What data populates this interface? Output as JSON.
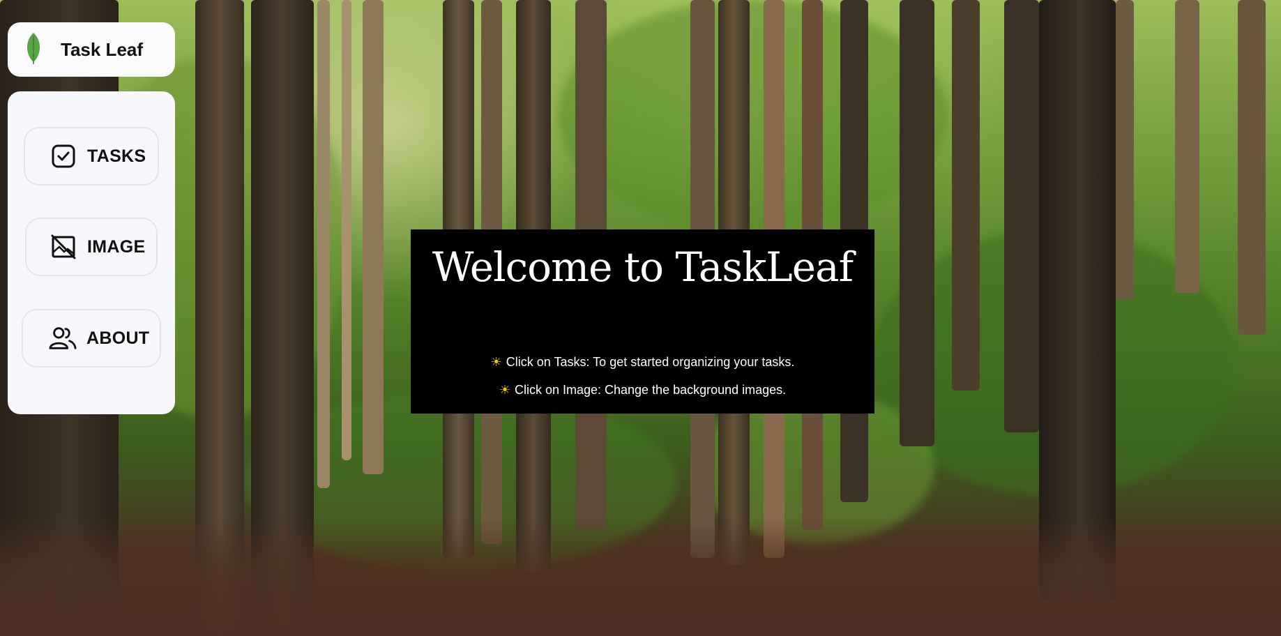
{
  "brand": {
    "title": "Task Leaf",
    "icon": "leaf-icon",
    "accent": "#5aa645"
  },
  "nav": {
    "items": [
      {
        "label": "TASKS",
        "icon": "task-check-icon"
      },
      {
        "label": "IMAGE",
        "icon": "image-off-icon"
      },
      {
        "label": "ABOUT",
        "icon": "users-icon"
      }
    ]
  },
  "welcome": {
    "title": "Welcome to TaskLeaf",
    "hints": [
      {
        "icon": "sun-icon",
        "text": "Click on Tasks: To get started organizing your tasks."
      },
      {
        "icon": "sun-icon",
        "text": "Click on Image: Change the background images."
      }
    ]
  },
  "colors": {
    "panel": "#f7f8fb",
    "welcome_bg": "#000000",
    "sun": "#f5c400"
  }
}
